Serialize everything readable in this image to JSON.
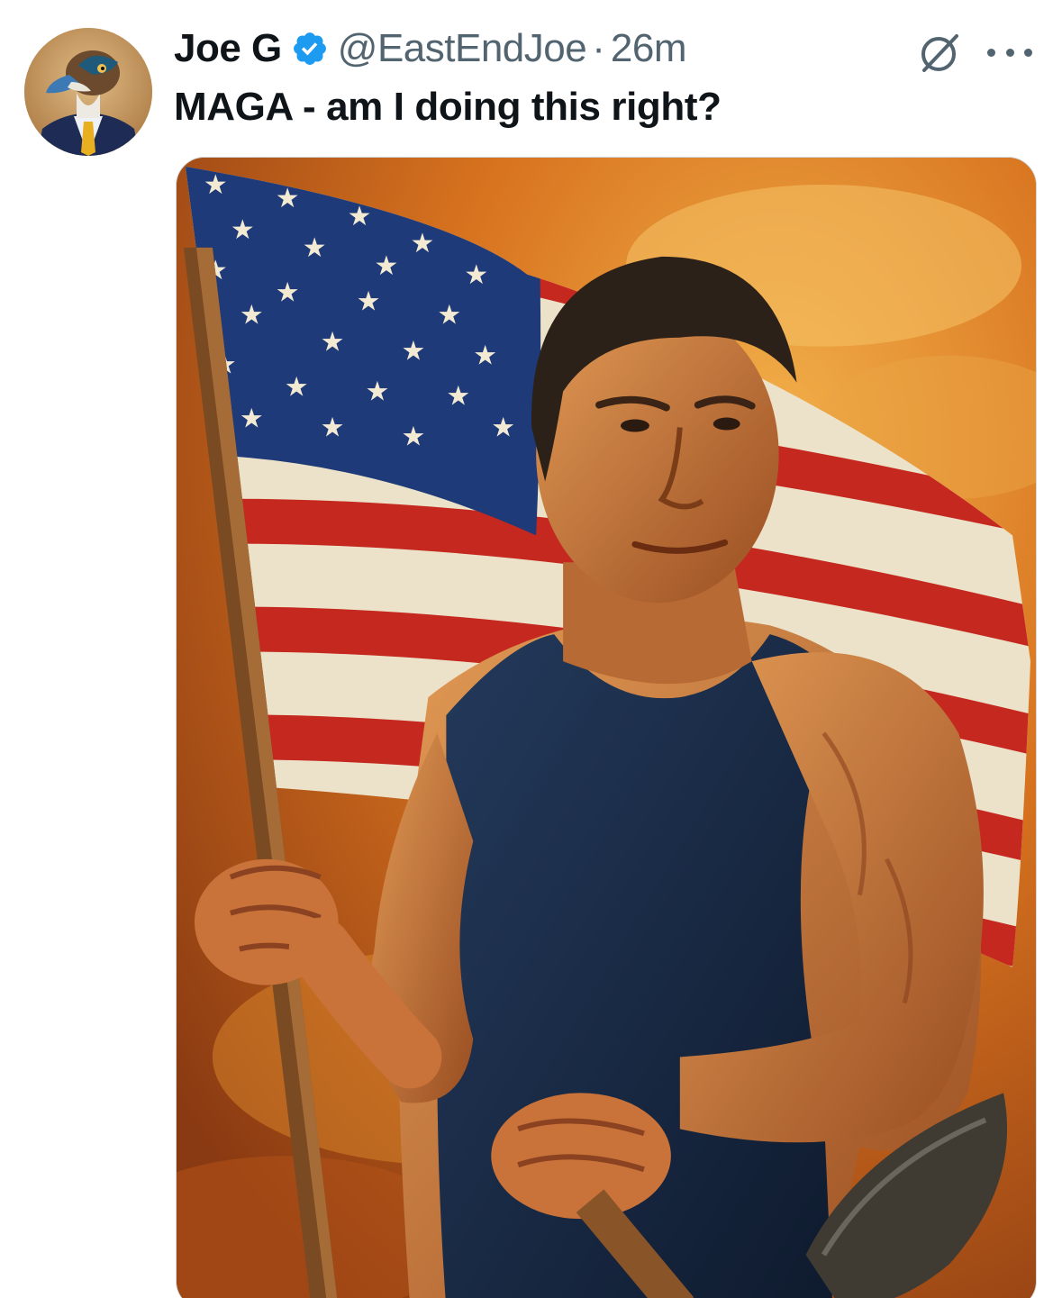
{
  "tweet": {
    "author": {
      "display_name": "Joe G",
      "handle": "@EastEndJoe",
      "verified": true,
      "avatar_icon": "duck-in-suit-avatar"
    },
    "separator": "·",
    "timestamp": "26m",
    "text": "MAGA - am I doing this right?",
    "media": {
      "type": "illustration",
      "icon": "flag-bearer-poster-image"
    },
    "actions": {
      "grok_icon": "grok-icon",
      "more_icon": "more-options-icon"
    }
  },
  "colors": {
    "verified_blue": "#1d9bf0",
    "secondary_text": "#536471",
    "primary_text": "#0f1419"
  }
}
